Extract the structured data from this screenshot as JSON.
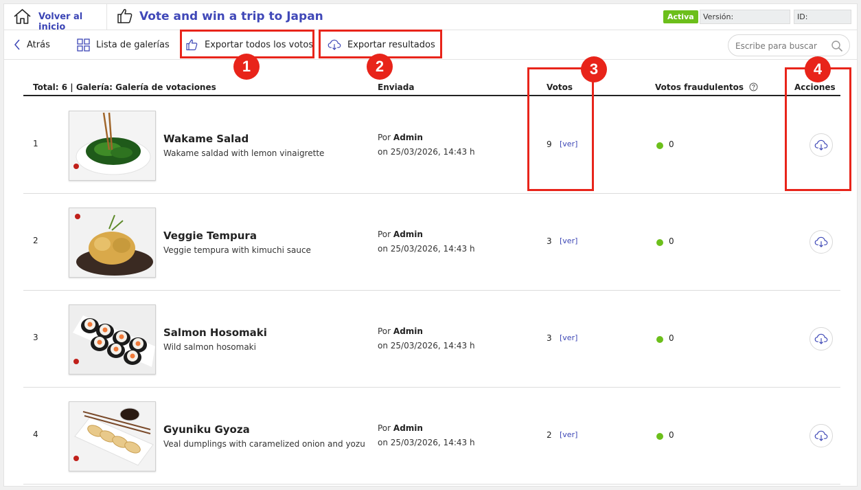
{
  "topbar": {
    "home_label": "Volver al inicio",
    "title": "Vote and win a trip to Japan",
    "status": "Activa",
    "version_label": "Versión:",
    "id_label": "ID:",
    "status_color": "#6cbf1b",
    "accent_color": "#3b45b5"
  },
  "toolbar": {
    "back_label": "Atrás",
    "galleries_label": "Lista de galerías",
    "export_votes_label": "Exportar todos los votos",
    "export_results_label": "Exportar resultados",
    "search_placeholder": "Escribe para buscar"
  },
  "callouts": [
    "1",
    "2",
    "3",
    "4"
  ],
  "table": {
    "summary": "Total: 6 | Galería: Galería de votaciones",
    "col_sent": "Enviada",
    "col_votes": "Votos",
    "col_fraud": "Votos fraudulentos",
    "col_actions": "Acciones",
    "view_link": "[ver]",
    "by_label": "Por",
    "rows": [
      {
        "index": "1",
        "title": "Wakame Salad",
        "description": "Wakame saldad with lemon vinaigrette",
        "author": "Admin",
        "date": "on 25/03/2026, 14:43 h",
        "votes": "9",
        "fraud": "0",
        "image": "wakame-salad"
      },
      {
        "index": "2",
        "title": "Veggie Tempura",
        "description": "Veggie tempura with kimuchi sauce",
        "author": "Admin",
        "date": "on 25/03/2026, 14:43 h",
        "votes": "3",
        "fraud": "0",
        "image": "veggie-tempura"
      },
      {
        "index": "3",
        "title": "Salmon Hosomaki",
        "description": "Wild salmon hosomaki",
        "author": "Admin",
        "date": "on 25/03/2026, 14:43 h",
        "votes": "3",
        "fraud": "0",
        "image": "salmon-hosomaki"
      },
      {
        "index": "4",
        "title": "Gyuniku Gyoza",
        "description": "Veal dumplings with caramelized onion and yozu",
        "author": "Admin",
        "date": "on 25/03/2026, 14:43 h",
        "votes": "2",
        "fraud": "0",
        "image": "gyuniku-gyoza"
      }
    ]
  }
}
